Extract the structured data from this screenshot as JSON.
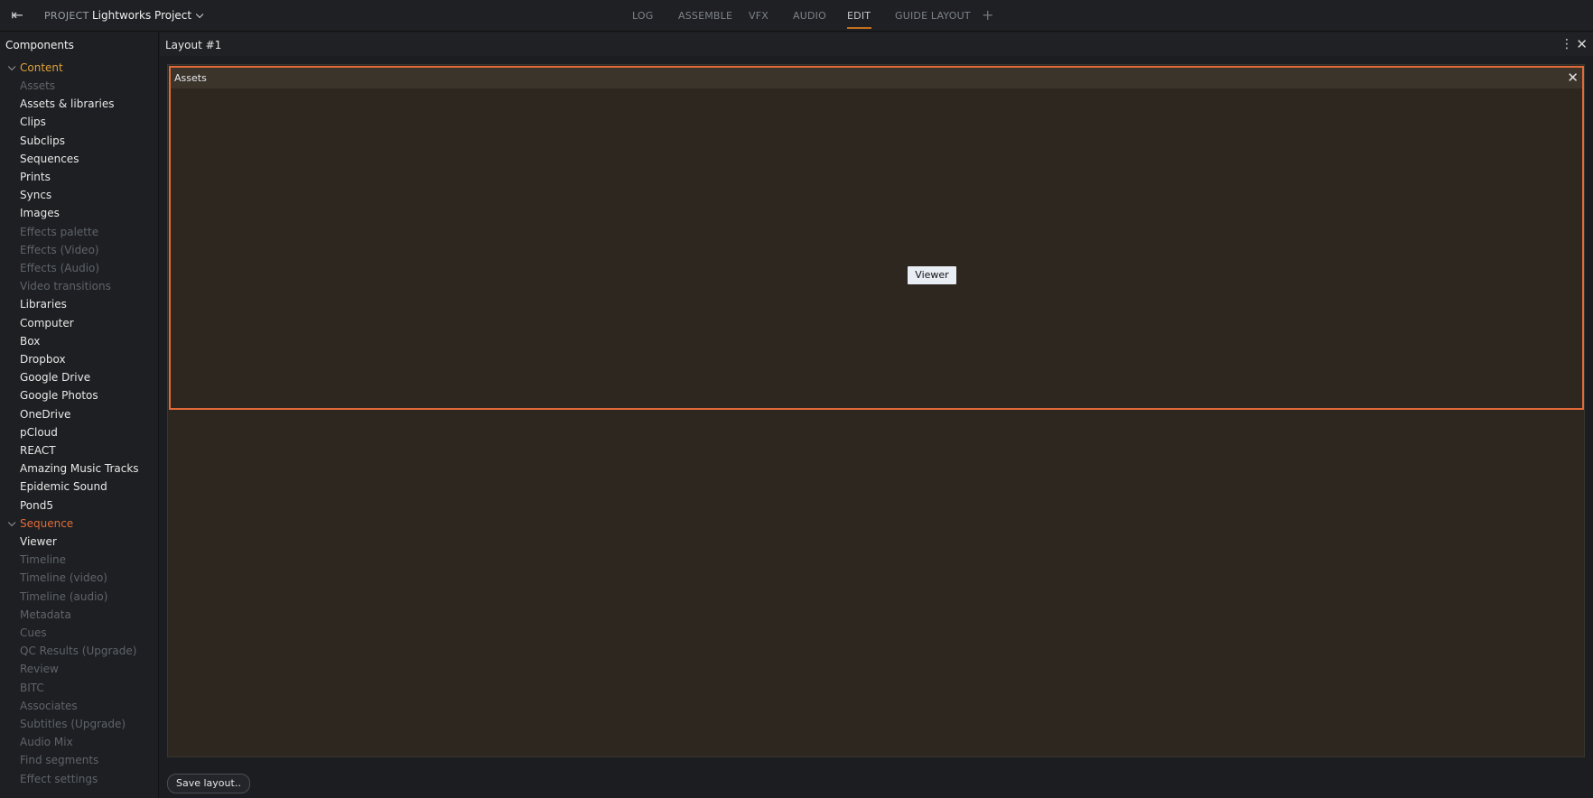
{
  "header": {
    "project_label": "PROJECT",
    "project_name": "Lightworks Project",
    "tabs": [
      "LOG",
      "ASSEMBLE",
      "VFX",
      "AUDIO",
      "EDIT",
      "GUIDE LAYOUT"
    ],
    "active_tab": "EDIT",
    "add_tab": "+"
  },
  "sidebar": {
    "title": "Components",
    "content_group": "Content",
    "content_items": [
      {
        "label": "Assets",
        "enabled": false
      },
      {
        "label": "Assets & libraries",
        "enabled": true
      },
      {
        "label": "Clips",
        "enabled": true
      },
      {
        "label": "Subclips",
        "enabled": true
      },
      {
        "label": "Sequences",
        "enabled": true
      },
      {
        "label": "Prints",
        "enabled": true
      },
      {
        "label": "Syncs",
        "enabled": true
      },
      {
        "label": "Images",
        "enabled": true
      },
      {
        "label": "Effects palette",
        "enabled": false
      },
      {
        "label": "Effects (Video)",
        "enabled": false
      },
      {
        "label": "Effects (Audio)",
        "enabled": false
      },
      {
        "label": "Video transitions",
        "enabled": false
      },
      {
        "label": "Libraries",
        "enabled": true
      },
      {
        "label": "Computer",
        "enabled": true
      },
      {
        "label": "Box",
        "enabled": true
      },
      {
        "label": "Dropbox",
        "enabled": true
      },
      {
        "label": "Google Drive",
        "enabled": true
      },
      {
        "label": "Google Photos",
        "enabled": true
      },
      {
        "label": "OneDrive",
        "enabled": true
      },
      {
        "label": "pCloud",
        "enabled": true
      },
      {
        "label": "REACT",
        "enabled": true
      },
      {
        "label": "Amazing Music Tracks",
        "enabled": true
      },
      {
        "label": "Epidemic Sound",
        "enabled": true
      },
      {
        "label": "Pond5",
        "enabled": true
      }
    ],
    "sequence_group": "Sequence",
    "sequence_items": [
      {
        "label": "Viewer",
        "enabled": true
      },
      {
        "label": "Timeline",
        "enabled": false
      },
      {
        "label": "Timeline (video)",
        "enabled": false
      },
      {
        "label": "Timeline (audio)",
        "enabled": false
      },
      {
        "label": "Metadata",
        "enabled": false
      },
      {
        "label": "Cues",
        "enabled": false
      },
      {
        "label": "QC Results (Upgrade)",
        "enabled": false
      },
      {
        "label": "Review",
        "enabled": false
      },
      {
        "label": "BITC",
        "enabled": false
      },
      {
        "label": "Associates",
        "enabled": false
      },
      {
        "label": "Subtitles (Upgrade)",
        "enabled": false
      },
      {
        "label": "Audio Mix",
        "enabled": false
      },
      {
        "label": "Find segments",
        "enabled": false
      },
      {
        "label": "Effect settings",
        "enabled": false
      }
    ]
  },
  "main": {
    "layout_title": "Layout #1",
    "panel_title": "Assets",
    "drag_label": "Viewer",
    "save_button": "Save layout.."
  },
  "colors": {
    "accent_orange": "#e26a3a",
    "content_group": "#e0a03a",
    "active_tab_underline": "#c2701f",
    "workspace_bg": "#2d2720"
  }
}
